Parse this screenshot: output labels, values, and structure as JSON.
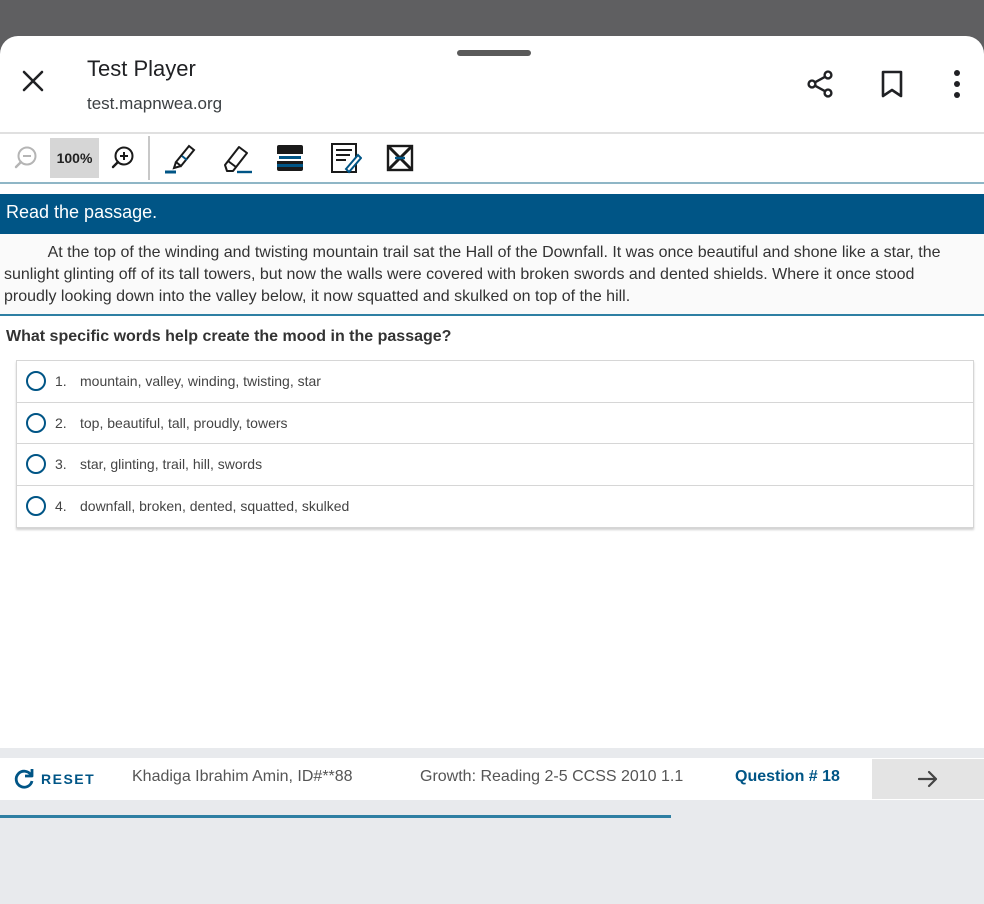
{
  "browser": {
    "title": "Test Player",
    "url": "test.mapnwea.org",
    "icons": [
      "close-icon",
      "share-icon",
      "bookmark-icon",
      "more-vert-icon"
    ]
  },
  "toolbar": {
    "zoom_level": "100%",
    "tools": [
      "zoom-out-icon",
      "zoom-in-icon",
      "highlighter-icon",
      "eraser-icon",
      "line-reader-icon",
      "notepad-icon",
      "answer-eliminator-icon"
    ]
  },
  "passage": {
    "header": "Read the passage.",
    "lines": [
      "          At the top of the winding and twisting mountain trail sat the Hall of the Downfall. It was once beautiful and shone like a star, the",
      "sunlight glinting off of its tall towers, but now the walls were covered with broken swords and dented shields. Where it once stood",
      "proudly looking down into the valley below, it now squatted and skulked on top of the hill."
    ]
  },
  "question": {
    "prompt": "What specific words help create the mood in the passage?",
    "choices": [
      {
        "num": "1.",
        "text": "mountain, valley, winding, twisting, star"
      },
      {
        "num": "2.",
        "text": "top, beautiful, tall, proudly, towers"
      },
      {
        "num": "3.",
        "text": "star, glinting, trail, hill, swords"
      },
      {
        "num": "4.",
        "text": "downfall, broken, dented, squatted, skulked"
      }
    ]
  },
  "footer": {
    "reset_label": "RESET",
    "student": "Khadiga Ibrahim Amin, ID#**88",
    "test_name": "Growth: Reading 2-5 CCSS 2010 1.1",
    "question_number": "Question # 18"
  },
  "colors": {
    "accent": "#005586",
    "status_bar": "#5f5f61",
    "progress": "#2e7fa3"
  }
}
